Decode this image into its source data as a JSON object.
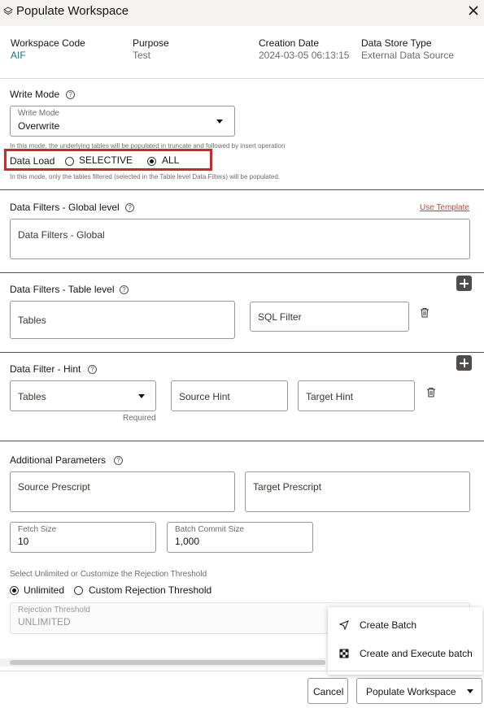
{
  "dialog": {
    "title": "Populate Workspace"
  },
  "meta": {
    "workspace_code_label": "Workspace Code",
    "workspace_code": "AIF",
    "purpose_label": "Purpose",
    "purpose": "Test",
    "creation_date_label": "Creation Date",
    "creation_date": "2024-03-05 06:13:15",
    "data_store_type_label": "Data Store Type",
    "data_store_type": "External Data Source"
  },
  "write_mode": {
    "title": "Write Mode",
    "field_label": "Write Mode",
    "value": "Overwrite",
    "hint": "In this mode, the underlying tables will be populated in truncate and followed by insert operation"
  },
  "data_load": {
    "label": "Data Load",
    "options": [
      "SELECTIVE",
      "ALL"
    ],
    "selected": "ALL",
    "hint": "In this mode, only the tables filtered (selected in the Table level Data Filters) will be populated."
  },
  "global_filters": {
    "title": "Data Filters - Global level",
    "use_template": "Use Template",
    "placeholder": "Data Filters - Global"
  },
  "table_filters": {
    "title": "Data Filters - Table level",
    "tables_placeholder": "Tables",
    "sql_placeholder": "SQL Filter"
  },
  "hint_filter": {
    "title": "Data Filter - Hint",
    "tables_placeholder": "Tables",
    "required": "Required",
    "source_hint": "Source Hint",
    "target_hint": "Target Hint"
  },
  "additional": {
    "title": "Additional Parameters",
    "source_prescript": "Source Prescript",
    "target_prescript": "Target Prescript",
    "fetch_size_label": "Fetch Size",
    "fetch_size": "10",
    "batch_commit_label": "Batch Commit Size",
    "batch_commit": "1,000"
  },
  "rejection": {
    "caption": "Select Unlimited or Customize the Rejection Threshold",
    "options": [
      "Unlimited",
      "Custom Rejection Threshold"
    ],
    "selected": "Unlimited",
    "threshold_label": "Rejection Threshold",
    "threshold_value": "UNLIMITED"
  },
  "popup_menu": {
    "items": [
      "Create Batch",
      "Create and Execute batch"
    ]
  },
  "footer": {
    "cancel": "Cancel",
    "populate": "Populate Workspace"
  },
  "colors": {
    "accent_link": "#117296",
    "highlight": "#d92128",
    "template_link": "#c74634"
  }
}
